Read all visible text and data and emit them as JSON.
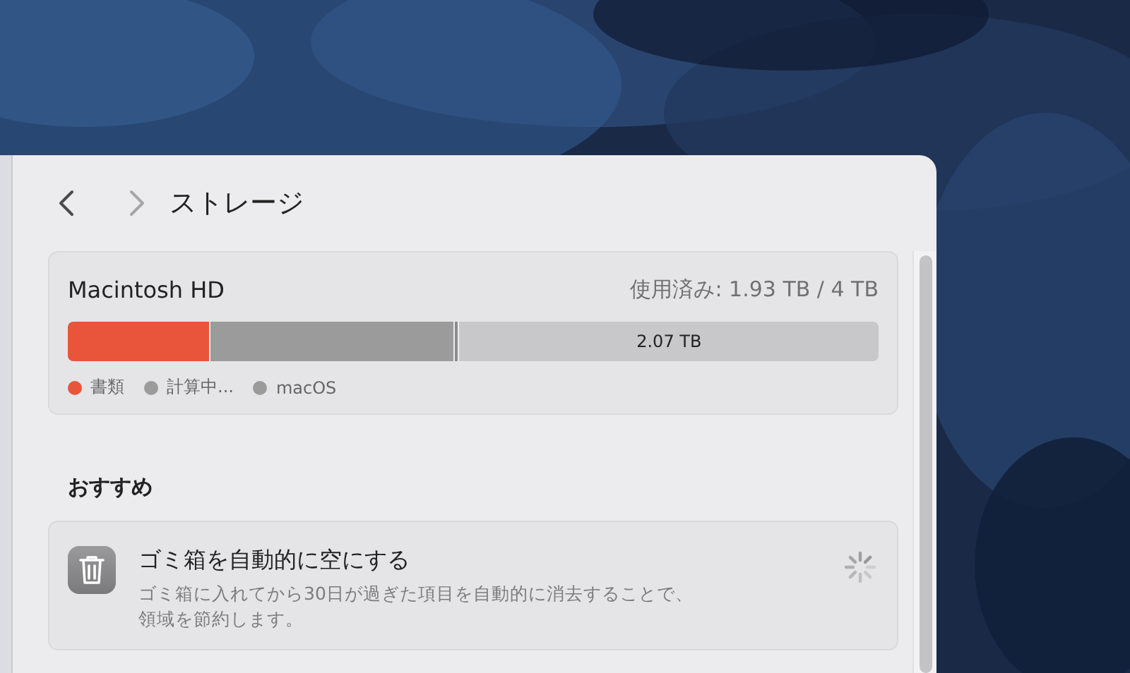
{
  "window": {
    "title": "ストレージ"
  },
  "navigation": [
    {
      "kind": "back",
      "disabled": false
    },
    {
      "kind": "forward",
      "disabled": true
    }
  ],
  "disk": {
    "name": "Macintosh HD",
    "usage": "使用済み: 1.93 TB / 4 TB",
    "segments": [
      {
        "kind": "used",
        "color": "#e8553a",
        "level": 0.174
      },
      {
        "kind": "used",
        "color": "#9b9b9b",
        "level": 0.3
      },
      {
        "kind": "used",
        "color": "#8a8a8a",
        "level": 0.004
      },
      {
        "kind": "free",
        "label": "2.07 TB"
      }
    ],
    "legend": [
      {
        "label": "書類",
        "color": "#e8553a"
      },
      {
        "label": "計算中...",
        "color": "#9b9b9b"
      },
      {
        "label": "macOS",
        "color": "#9b9b9b"
      }
    ]
  },
  "recommendations": {
    "heading": "おすすめ",
    "items": [
      {
        "title": "ゴミ箱を自動的に空にする",
        "description": "ゴミ箱に入れてから30日が過ぎた項目を自動的に消去することで、領域を節約します。",
        "loading": true
      }
    ]
  }
}
